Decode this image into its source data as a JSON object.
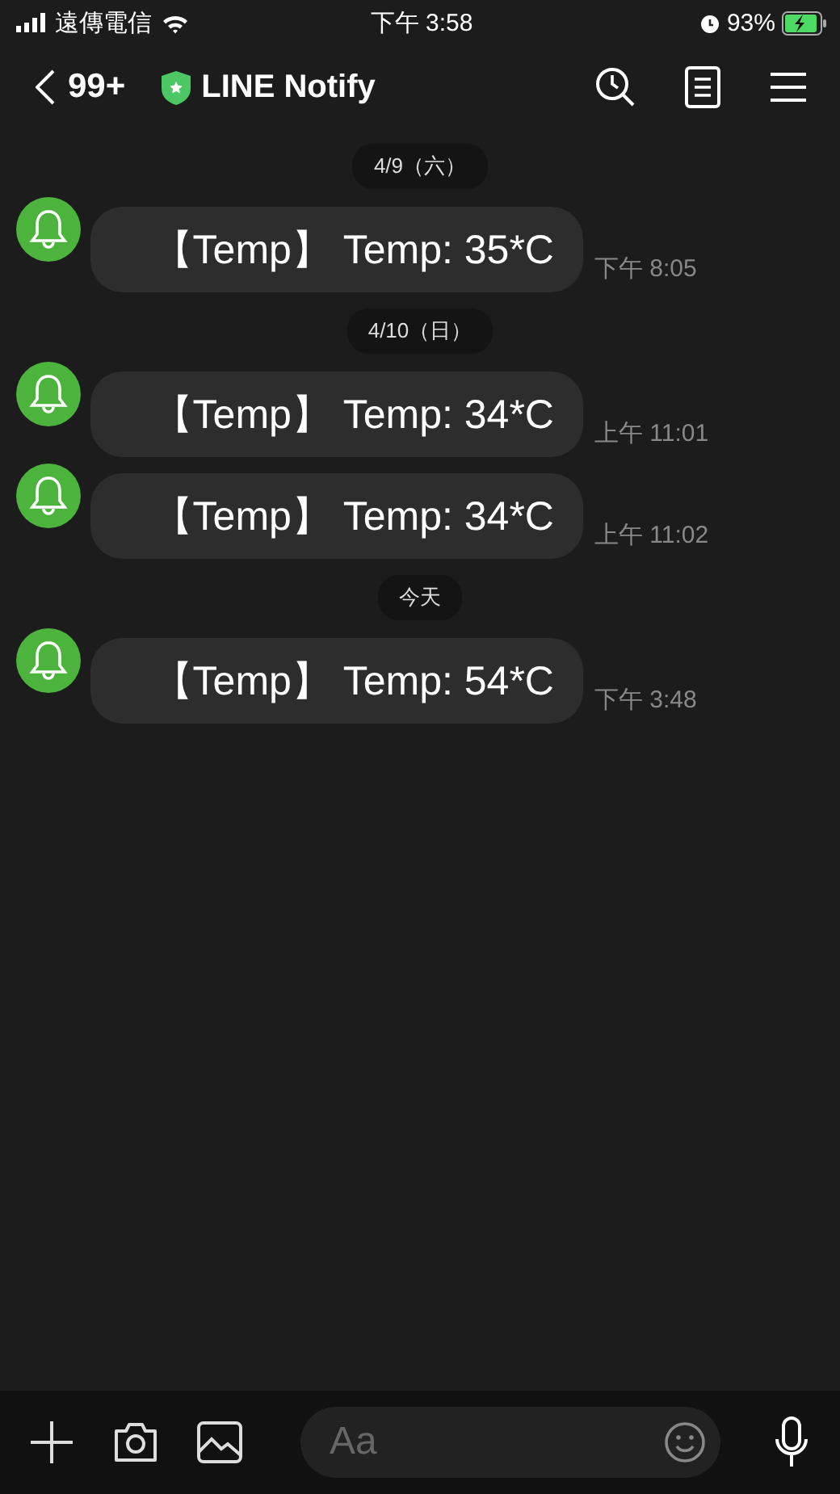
{
  "status_bar": {
    "carrier": "遠傳電信",
    "time": "下午 3:58",
    "battery": "93%",
    "charging": true
  },
  "header": {
    "back_count": "99+",
    "title": "LINE Notify"
  },
  "messages": [
    {
      "kind": "date",
      "text": "4/9（六）"
    },
    {
      "kind": "message",
      "text": "【Temp】 Temp: 35*C",
      "time": "下午 8:05"
    },
    {
      "kind": "date",
      "text": "4/10（日）"
    },
    {
      "kind": "message",
      "text": "【Temp】 Temp: 34*C",
      "time": "上午 11:01"
    },
    {
      "kind": "message",
      "text": "【Temp】 Temp: 34*C",
      "time": "上午 11:02"
    },
    {
      "kind": "date",
      "text": "今天"
    },
    {
      "kind": "message",
      "text": "【Temp】 Temp: 54*C",
      "time": "下午 3:48"
    }
  ],
  "composer": {
    "placeholder": "Aa"
  }
}
